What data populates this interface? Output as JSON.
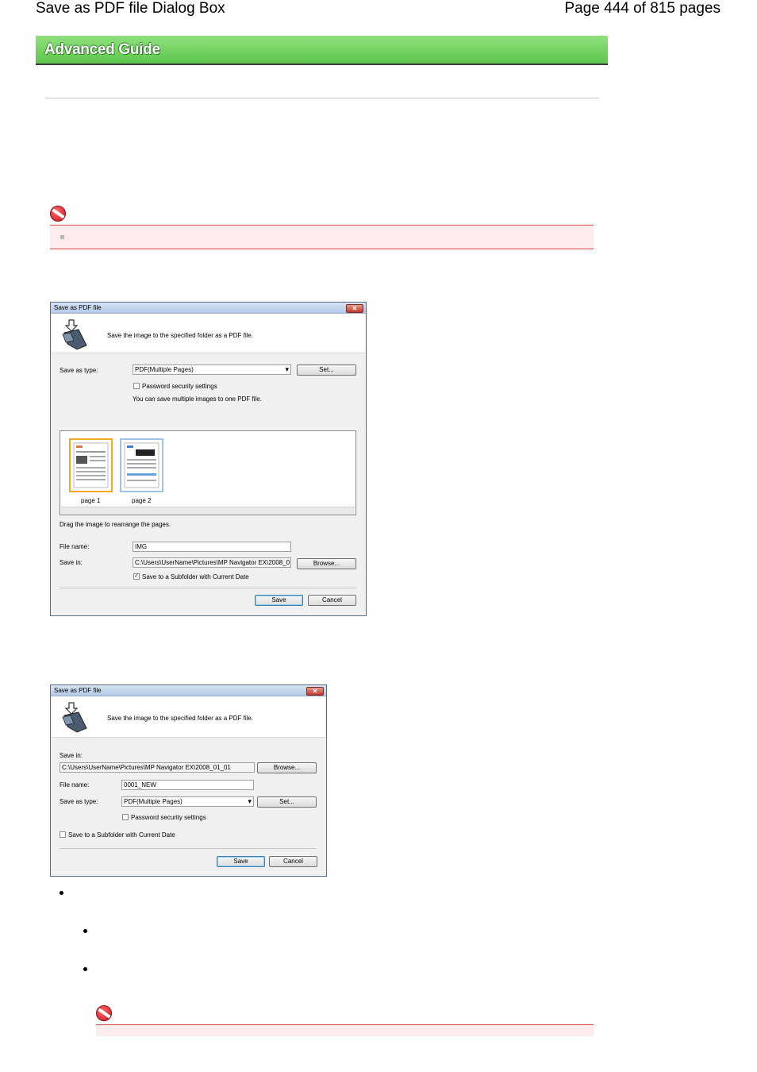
{
  "header": {
    "title": "Save as PDF file Dialog Box",
    "page_info": "Page 444 of 815 pages"
  },
  "banner": {
    "label": "Advanced Guide"
  },
  "dialog1": {
    "title": "Save as PDF file",
    "close": "✕",
    "description": "Save the image to the specified folder as a PDF file.",
    "save_as_type_label": "Save as type:",
    "save_as_type_value": "PDF(Multiple Pages)",
    "set_button": "Set...",
    "password_label": "Password security settings",
    "multi_note": "You can save multiple images to one PDF file.",
    "thumbnails": [
      "page 1",
      "page 2"
    ],
    "drag_note": "Drag the image to rearrange the pages.",
    "file_name_label": "File name:",
    "file_name_value": "IMG",
    "save_in_label": "Save in:",
    "save_in_value": "C:\\Users\\UserName\\Pictures\\MP Navigator EX\\2008_0",
    "browse_button": "Browse...",
    "subfolder_label": "Save to a Subfolder with Current Date",
    "subfolder_checked": "✓",
    "save_button": "Save",
    "cancel_button": "Cancel"
  },
  "dialog2": {
    "title": "Save as PDF file",
    "close": "✕",
    "description": "Save the image to the specified folder as a PDF file.",
    "save_in_label": "Save in:",
    "save_in_value": "C:\\Users\\UserName\\Pictures\\MP Navigator EX\\2008_01_01",
    "browse_button": "Browse...",
    "file_name_label": "File name:",
    "file_name_value": "0001_NEW",
    "save_as_type_label": "Save as type:",
    "save_as_type_value": "PDF(Multiple Pages)",
    "set_button": "Set...",
    "password_label": "Password security settings",
    "subfolder_label": "Save to a Subfolder with Current Date",
    "save_button": "Save",
    "cancel_button": "Cancel"
  },
  "colors": {
    "banner_green": "#5cc64a",
    "important_red": "#d84a4a",
    "important_bg": "#fdecec"
  }
}
